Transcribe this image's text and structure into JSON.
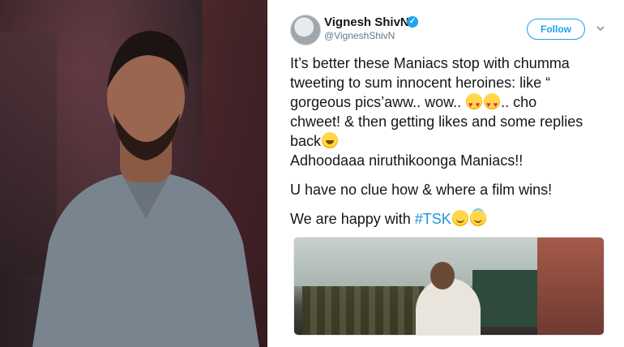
{
  "tweet": {
    "display_name": "Vignesh ShivN",
    "handle": "@VigneshShivN",
    "follow_label": "Follow",
    "verified_icon": "verified-badge-icon",
    "more_icon": "chevron-down-icon",
    "lines": [
      "It’s better these Maniacs stop with chumma",
      "tweeting to sum innocent heroines: like “",
      "gorgeous pics’aww.. wow..",
      ".. cho",
      "chweet! & then getting likes and some replies",
      "back",
      "Adhoodaaa niruthikoonga Maniacs!!",
      "U have no clue how & where a film wins!",
      "We are happy with",
      "#TSK"
    ]
  },
  "colors": {
    "accent": "#1da1f2",
    "hashtag": "#1b95e0",
    "text": "#14171a",
    "muted": "#657786"
  }
}
